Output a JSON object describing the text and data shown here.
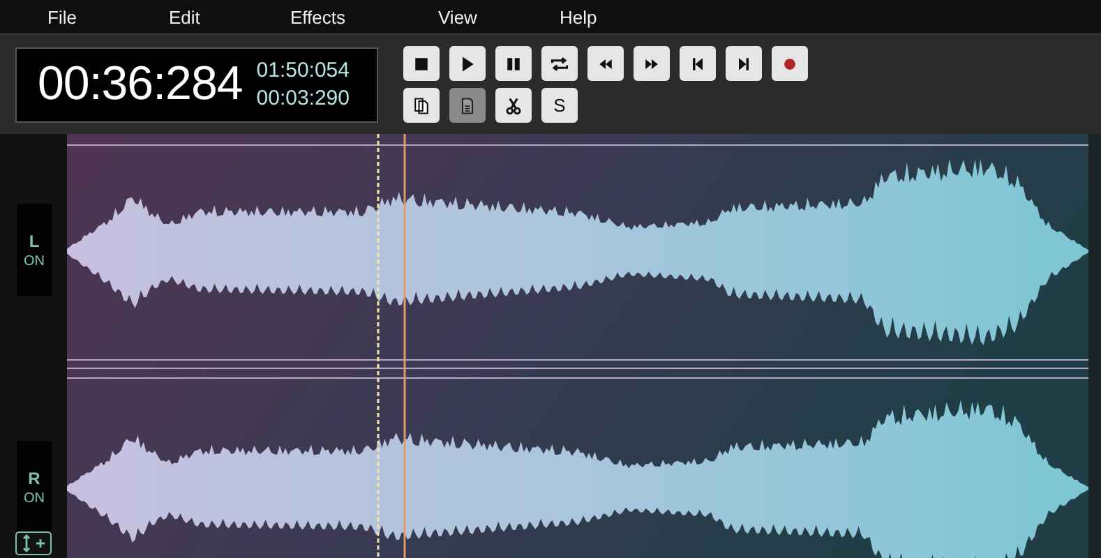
{
  "menu": [
    "File",
    "Edit",
    "Effects",
    "View",
    "Help"
  ],
  "time_display": {
    "position": "00:36:284",
    "duration": "01:50:054",
    "selection": "00:03:290"
  },
  "transport_buttons": [
    {
      "kind": "stop",
      "pressed": false
    },
    {
      "kind": "play",
      "pressed": false
    },
    {
      "kind": "pause",
      "pressed": false
    },
    {
      "kind": "loop",
      "pressed": false
    },
    {
      "kind": "rewind",
      "pressed": false
    },
    {
      "kind": "forward",
      "pressed": false
    },
    {
      "kind": "skip-start",
      "pressed": false
    },
    {
      "kind": "skip-end",
      "pressed": false
    },
    {
      "kind": "record",
      "pressed": false
    }
  ],
  "edit_buttons": [
    {
      "kind": "copy",
      "pressed": false
    },
    {
      "kind": "paste",
      "pressed": true
    },
    {
      "kind": "cut",
      "pressed": false
    },
    {
      "kind": "text",
      "label": "S",
      "pressed": false
    }
  ],
  "channels": [
    {
      "label": "L",
      "state": "ON",
      "on": true
    },
    {
      "label": "R",
      "state": "ON",
      "on": true
    }
  ]
}
